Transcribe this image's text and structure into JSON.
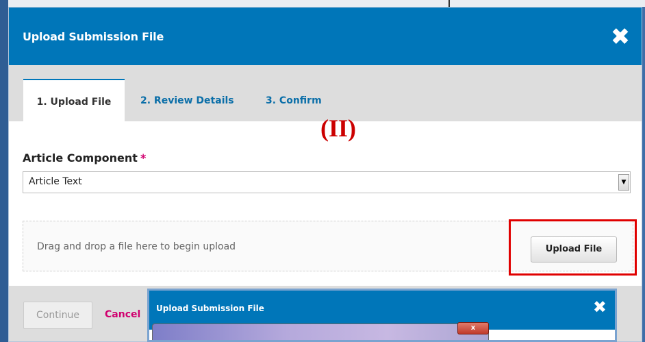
{
  "modal": {
    "title": "Upload Submission File",
    "close_icon": "close-icon",
    "tabs": [
      {
        "label": "1. Upload File",
        "active": true
      },
      {
        "label": "2. Review Details",
        "active": false
      },
      {
        "label": "3. Confirm",
        "active": false
      }
    ],
    "overlay_label": "(II)",
    "field": {
      "label": "Article Component",
      "required_mark": "*",
      "selected": "Article Text"
    },
    "dropzone": {
      "text": "Drag and drop a file here to begin upload",
      "button_label": "Upload File"
    },
    "footer": {
      "continue_label": "Continue",
      "cancel_label": "Cancel"
    }
  },
  "inset": {
    "title": "Upload Submission File",
    "close_icon": "close-icon",
    "window_close_label": "x"
  },
  "colors": {
    "header": "#0076b9",
    "link": "#0a6ea8",
    "required": "#d0006f",
    "highlight": "#e00000"
  }
}
